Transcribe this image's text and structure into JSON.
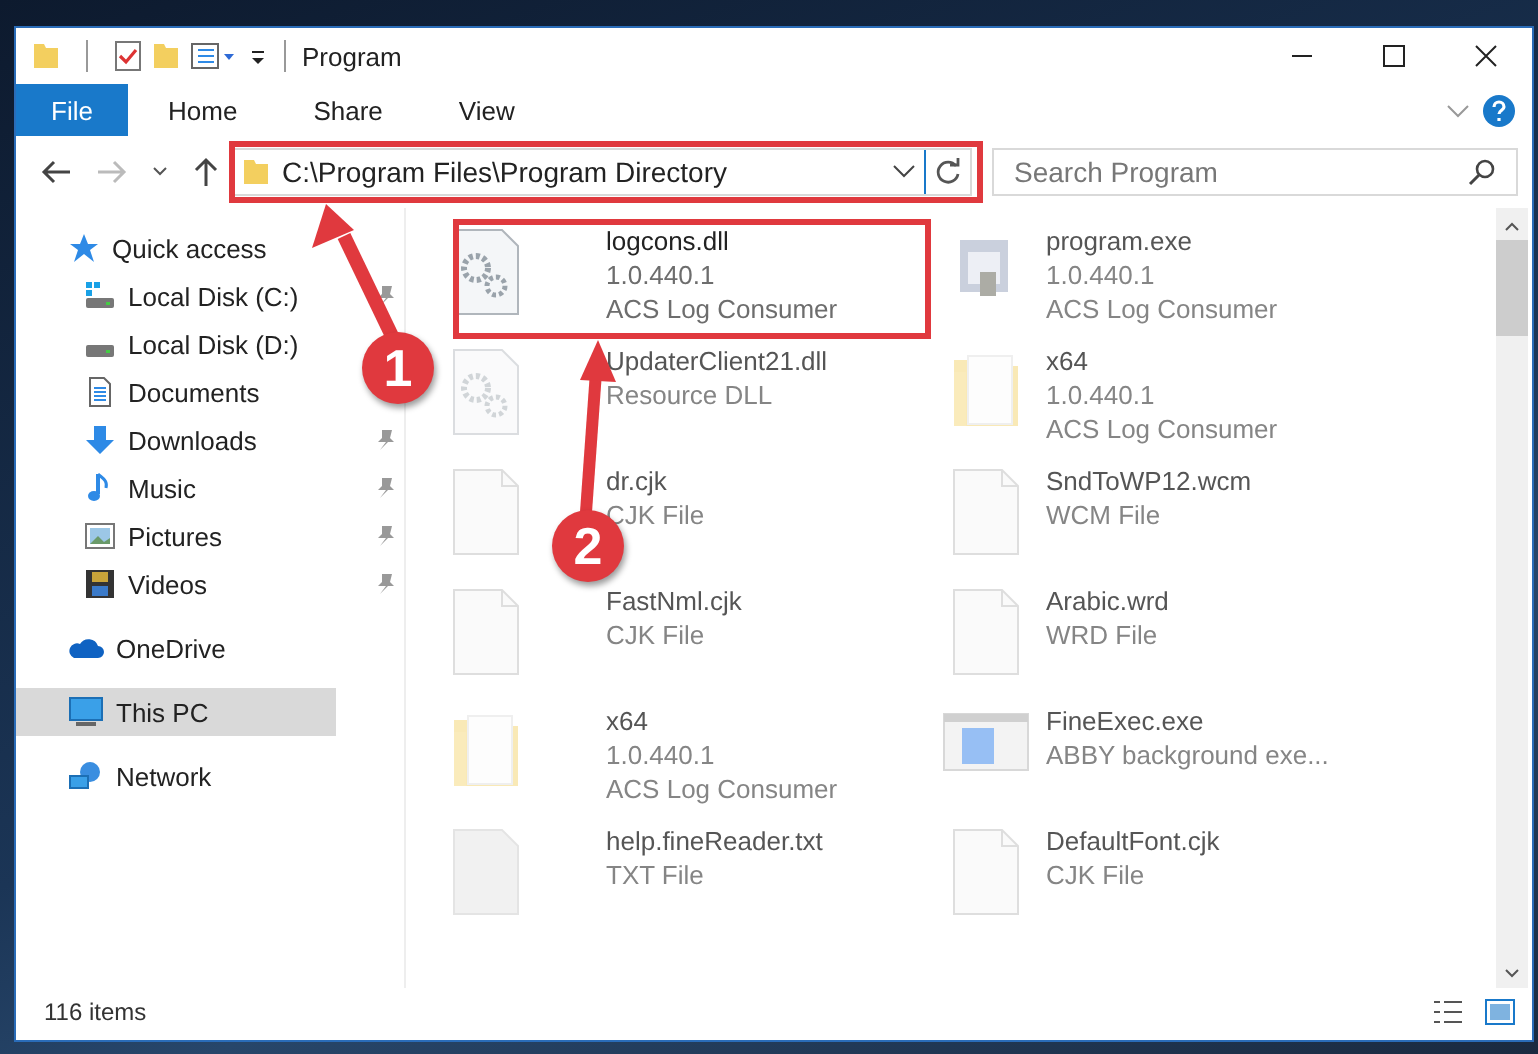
{
  "window": {
    "title": "Program"
  },
  "ribbon": {
    "tabs": [
      {
        "label": "File",
        "selected": true
      },
      {
        "label": "Home",
        "selected": false
      },
      {
        "label": "Share",
        "selected": false
      },
      {
        "label": "View",
        "selected": false
      }
    ]
  },
  "address_bar": {
    "path": "C:\\Program Files\\Program Directory"
  },
  "search": {
    "placeholder": "Search Program"
  },
  "sidebar": {
    "items": [
      {
        "label": "Quick access",
        "kind": "star",
        "pinned": false,
        "selected": false,
        "children": [
          {
            "label": "Local Disk (C:)",
            "kind": "disk-c",
            "pinned": true,
            "selected": false
          },
          {
            "label": "Local Disk (D:)",
            "kind": "disk",
            "pinned": false,
            "selected": false
          },
          {
            "label": "Documents",
            "kind": "documents",
            "pinned": false,
            "selected": false
          },
          {
            "label": "Downloads",
            "kind": "downloads",
            "pinned": true,
            "selected": false
          },
          {
            "label": "Music",
            "kind": "music",
            "pinned": true,
            "selected": false
          },
          {
            "label": "Pictures",
            "kind": "pictures",
            "pinned": true,
            "selected": false
          },
          {
            "label": "Videos",
            "kind": "videos",
            "pinned": true,
            "selected": false
          }
        ]
      },
      {
        "label": "OneDrive",
        "kind": "cloud",
        "pinned": false,
        "selected": false
      },
      {
        "label": "This PC",
        "kind": "pc",
        "pinned": false,
        "selected": true
      },
      {
        "label": "Network",
        "kind": "network",
        "pinned": false,
        "selected": false
      }
    ]
  },
  "files": [
    {
      "name": "logcons.dll",
      "details": [
        "1.0.440.1",
        "ACS Log Consumer"
      ],
      "kind": "dll",
      "faded": false
    },
    {
      "name": "program.exe",
      "details": [
        "1.0.440.1",
        "ACS Log Consumer"
      ],
      "kind": "exe",
      "faded": true
    },
    {
      "name": "UpdaterClient21.dll",
      "details": [
        "Resource DLL"
      ],
      "kind": "dll",
      "faded": true
    },
    {
      "name": "x64",
      "details": [
        "1.0.440.1",
        "ACS Log Consumer"
      ],
      "kind": "folder",
      "faded": true
    },
    {
      "name": "dr.cjk",
      "details": [
        "CJK File"
      ],
      "kind": "blank",
      "faded": true
    },
    {
      "name": "SndToWP12.wcm",
      "details": [
        "WCM File"
      ],
      "kind": "blank",
      "faded": true
    },
    {
      "name": "FastNml.cjk",
      "details": [
        "CJK File"
      ],
      "kind": "blank",
      "faded": true
    },
    {
      "name": "Arabic.wrd",
      "details": [
        "WRD File"
      ],
      "kind": "blank",
      "faded": true
    },
    {
      "name": "x64",
      "details": [
        "1.0.440.1",
        "ACS Log Consumer"
      ],
      "kind": "folder",
      "faded": true
    },
    {
      "name": "FineExec.exe",
      "details": [
        "ABBY background exe..."
      ],
      "kind": "app",
      "faded": true
    },
    {
      "name": "help.fineReader.txt",
      "details": [
        "TXT File"
      ],
      "kind": "text",
      "faded": true
    },
    {
      "name": "DefaultFont.cjk",
      "details": [
        "CJK File"
      ],
      "kind": "blank",
      "faded": true
    }
  ],
  "status_bar": {
    "item_count": "116 items"
  },
  "annotations": [
    {
      "number": "1"
    },
    {
      "number": "2"
    }
  ]
}
